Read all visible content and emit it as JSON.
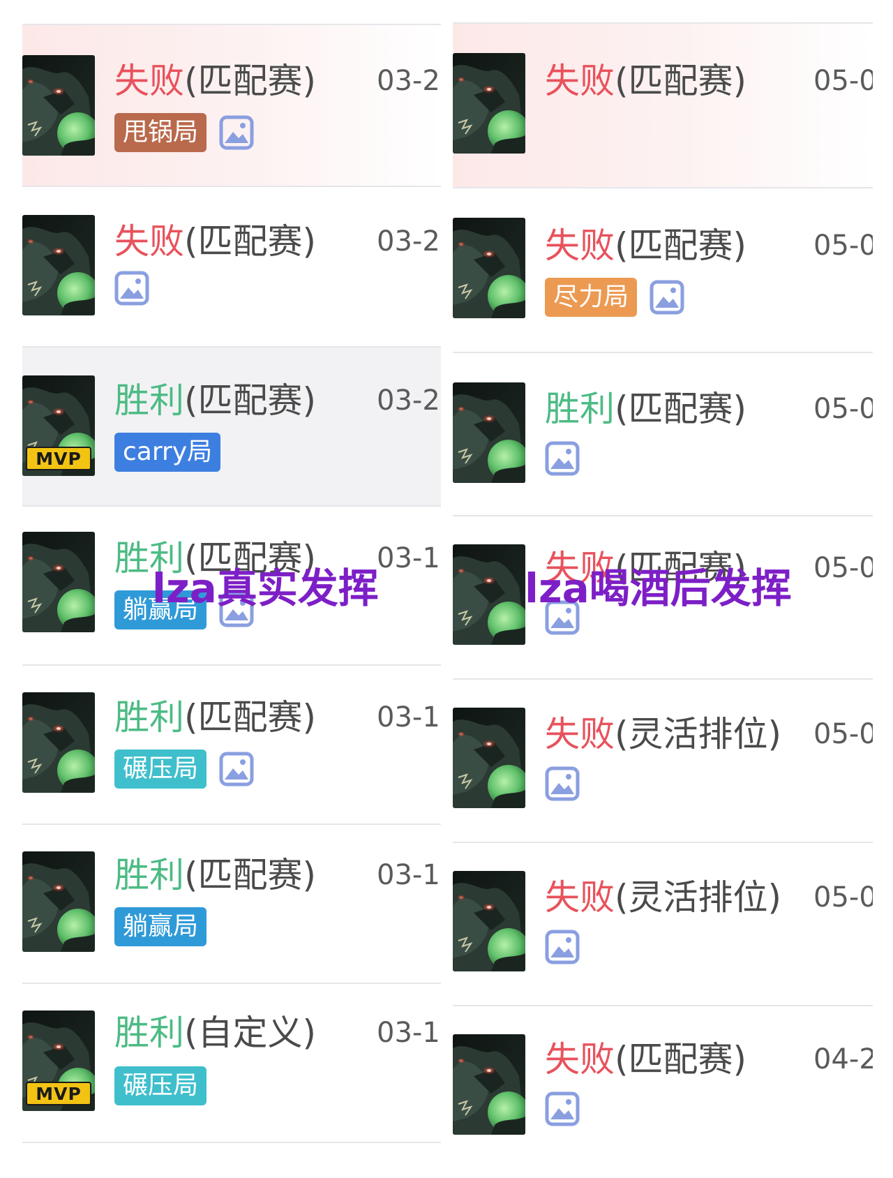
{
  "colors": {
    "loss": "#e8525c",
    "win": "#4cbb84",
    "mode_text": "#4a4a4a",
    "date_text": "#5a5a5a",
    "overlay_text": "#7d1fc6",
    "tag_甩锅局": "#b96a4c",
    "tag_carry局": "#3d7fe0",
    "tag_躺赢局": "#2f9ad8",
    "tag_碾压局": "#3fbfcc",
    "tag_尽力局": "#ec9a52",
    "image_icon": "#8a9fe0",
    "mvp_badge": "#f2c313"
  },
  "overlays": {
    "left": "lza真实发挥",
    "right": "lza喝酒后发挥"
  },
  "left_column": {
    "matches": [
      {
        "result": "失败",
        "mode": "(匹配赛)",
        "date": "03-2",
        "tag": "甩锅局",
        "image_icon": true,
        "mvp": false,
        "outcome": "loss"
      },
      {
        "result": "失败",
        "mode": "(匹配赛)",
        "date": "03-2",
        "tag": "",
        "image_icon": true,
        "mvp": false,
        "outcome": "loss"
      },
      {
        "result": "胜利",
        "mode": "(匹配赛)",
        "date": "03-2",
        "tag": "carry局",
        "image_icon": false,
        "mvp": true,
        "outcome": "win"
      },
      {
        "result": "胜利",
        "mode": "(匹配赛)",
        "date": "03-1",
        "tag": "躺赢局",
        "image_icon": true,
        "mvp": false,
        "outcome": "win"
      },
      {
        "result": "胜利",
        "mode": "(匹配赛)",
        "date": "03-1",
        "tag": "碾压局",
        "image_icon": true,
        "mvp": false,
        "outcome": "win"
      },
      {
        "result": "胜利",
        "mode": "(匹配赛)",
        "date": "03-1",
        "tag": "躺赢局",
        "image_icon": false,
        "mvp": false,
        "outcome": "win"
      },
      {
        "result": "胜利",
        "mode": "(自定义)",
        "date": "03-1",
        "tag": "碾压局",
        "image_icon": false,
        "mvp": true,
        "outcome": "win"
      }
    ]
  },
  "right_column": {
    "matches": [
      {
        "result": "失败",
        "mode": "(匹配赛)",
        "date": "05-0",
        "tag": "",
        "image_icon": false,
        "mvp": false,
        "outcome": "loss"
      },
      {
        "result": "失败",
        "mode": "(匹配赛)",
        "date": "05-0",
        "tag": "尽力局",
        "image_icon": true,
        "mvp": false,
        "outcome": "loss"
      },
      {
        "result": "胜利",
        "mode": "(匹配赛)",
        "date": "05-0",
        "tag": "",
        "image_icon": true,
        "mvp": false,
        "outcome": "win"
      },
      {
        "result": "失败",
        "mode": "(匹配赛)",
        "date": "05-0",
        "tag": "",
        "image_icon": true,
        "mvp": false,
        "outcome": "loss"
      },
      {
        "result": "失败",
        "mode": "(灵活排位)",
        "date": "05-0",
        "tag": "",
        "image_icon": true,
        "mvp": false,
        "outcome": "loss"
      },
      {
        "result": "失败",
        "mode": "(灵活排位)",
        "date": "05-0",
        "tag": "",
        "image_icon": true,
        "mvp": false,
        "outcome": "loss"
      },
      {
        "result": "失败",
        "mode": "(匹配赛)",
        "date": "04-2",
        "tag": "",
        "image_icon": true,
        "mvp": false,
        "outcome": "loss"
      }
    ]
  }
}
